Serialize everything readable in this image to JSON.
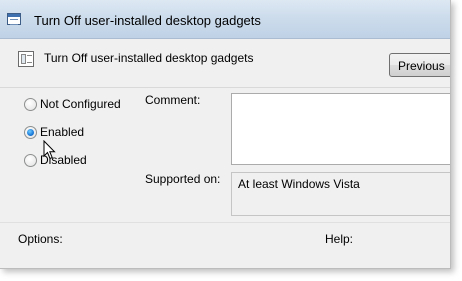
{
  "window": {
    "title": "Turn Off user-installed desktop gadgets",
    "title_icon": "policy-window-icon"
  },
  "header": {
    "policy_title": "Turn Off user-installed desktop gadgets",
    "policy_icon": "policy-setting-icon",
    "previous_button": "Previous"
  },
  "state_options": [
    {
      "label": "Not Configured",
      "checked": false
    },
    {
      "label": "Enabled",
      "checked": true
    },
    {
      "label": "Disabled",
      "checked": false
    }
  ],
  "fields": {
    "comment_label": "Comment:",
    "comment_value": "",
    "supported_label": "Supported on:",
    "supported_value": "At least Windows Vista"
  },
  "sections": {
    "options_label": "Options:",
    "help_label": "Help:"
  },
  "colors": {
    "accent": "#1a79d8",
    "title_bar": "#cddcec"
  }
}
